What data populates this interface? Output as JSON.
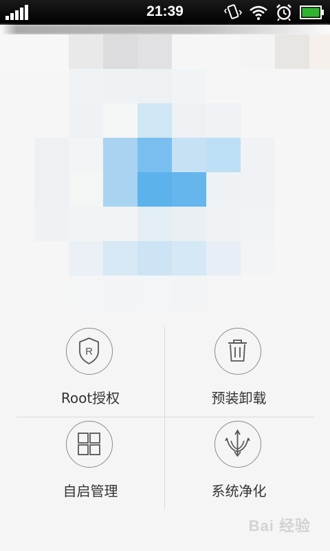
{
  "status_bar": {
    "time": "21:39",
    "icons": [
      "signal-icon",
      "vibrate-icon",
      "wifi-icon",
      "alarm-icon",
      "battery-icon"
    ]
  },
  "mosaic": {
    "description_colors": {
      "light": "#f2f4f6",
      "blue_light": "#b8d9f2",
      "blue_mid": "#7cc0ee",
      "blue_strong": "#5ab1ea"
    }
  },
  "tiles": [
    {
      "label": "Root授权",
      "icon": "shield-r-icon"
    },
    {
      "label": "预装卸载",
      "icon": "trash-icon"
    },
    {
      "label": "自启管理",
      "icon": "four-squares-icon"
    },
    {
      "label": "系统净化",
      "icon": "trident-icon"
    }
  ],
  "watermark": {
    "text": "Bai 经验"
  }
}
